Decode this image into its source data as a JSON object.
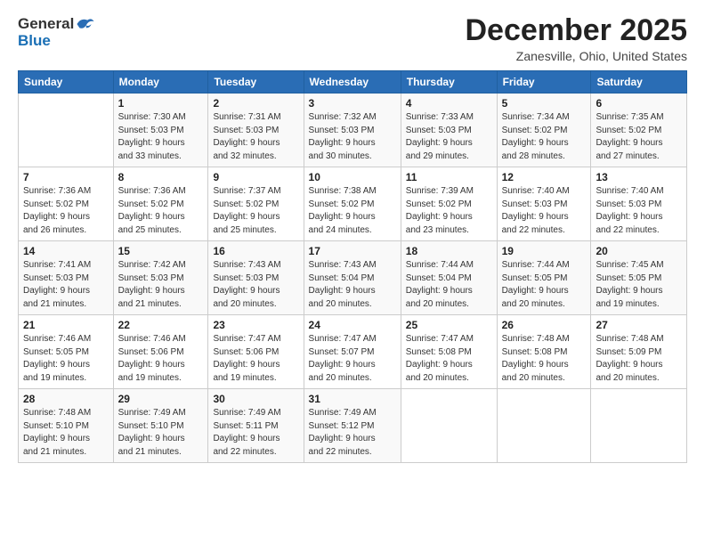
{
  "header": {
    "logo_line1": "General",
    "logo_line2": "Blue",
    "month": "December 2025",
    "location": "Zanesville, Ohio, United States"
  },
  "weekdays": [
    "Sunday",
    "Monday",
    "Tuesday",
    "Wednesday",
    "Thursday",
    "Friday",
    "Saturday"
  ],
  "weeks": [
    [
      {
        "day": "",
        "sunrise": "",
        "sunset": "",
        "daylight": ""
      },
      {
        "day": "1",
        "sunrise": "Sunrise: 7:30 AM",
        "sunset": "Sunset: 5:03 PM",
        "daylight": "Daylight: 9 hours and 33 minutes."
      },
      {
        "day": "2",
        "sunrise": "Sunrise: 7:31 AM",
        "sunset": "Sunset: 5:03 PM",
        "daylight": "Daylight: 9 hours and 32 minutes."
      },
      {
        "day": "3",
        "sunrise": "Sunrise: 7:32 AM",
        "sunset": "Sunset: 5:03 PM",
        "daylight": "Daylight: 9 hours and 30 minutes."
      },
      {
        "day": "4",
        "sunrise": "Sunrise: 7:33 AM",
        "sunset": "Sunset: 5:03 PM",
        "daylight": "Daylight: 9 hours and 29 minutes."
      },
      {
        "day": "5",
        "sunrise": "Sunrise: 7:34 AM",
        "sunset": "Sunset: 5:02 PM",
        "daylight": "Daylight: 9 hours and 28 minutes."
      },
      {
        "day": "6",
        "sunrise": "Sunrise: 7:35 AM",
        "sunset": "Sunset: 5:02 PM",
        "daylight": "Daylight: 9 hours and 27 minutes."
      }
    ],
    [
      {
        "day": "7",
        "sunrise": "Sunrise: 7:36 AM",
        "sunset": "Sunset: 5:02 PM",
        "daylight": "Daylight: 9 hours and 26 minutes."
      },
      {
        "day": "8",
        "sunrise": "Sunrise: 7:36 AM",
        "sunset": "Sunset: 5:02 PM",
        "daylight": "Daylight: 9 hours and 25 minutes."
      },
      {
        "day": "9",
        "sunrise": "Sunrise: 7:37 AM",
        "sunset": "Sunset: 5:02 PM",
        "daylight": "Daylight: 9 hours and 25 minutes."
      },
      {
        "day": "10",
        "sunrise": "Sunrise: 7:38 AM",
        "sunset": "Sunset: 5:02 PM",
        "daylight": "Daylight: 9 hours and 24 minutes."
      },
      {
        "day": "11",
        "sunrise": "Sunrise: 7:39 AM",
        "sunset": "Sunset: 5:02 PM",
        "daylight": "Daylight: 9 hours and 23 minutes."
      },
      {
        "day": "12",
        "sunrise": "Sunrise: 7:40 AM",
        "sunset": "Sunset: 5:03 PM",
        "daylight": "Daylight: 9 hours and 22 minutes."
      },
      {
        "day": "13",
        "sunrise": "Sunrise: 7:40 AM",
        "sunset": "Sunset: 5:03 PM",
        "daylight": "Daylight: 9 hours and 22 minutes."
      }
    ],
    [
      {
        "day": "14",
        "sunrise": "Sunrise: 7:41 AM",
        "sunset": "Sunset: 5:03 PM",
        "daylight": "Daylight: 9 hours and 21 minutes."
      },
      {
        "day": "15",
        "sunrise": "Sunrise: 7:42 AM",
        "sunset": "Sunset: 5:03 PM",
        "daylight": "Daylight: 9 hours and 21 minutes."
      },
      {
        "day": "16",
        "sunrise": "Sunrise: 7:43 AM",
        "sunset": "Sunset: 5:03 PM",
        "daylight": "Daylight: 9 hours and 20 minutes."
      },
      {
        "day": "17",
        "sunrise": "Sunrise: 7:43 AM",
        "sunset": "Sunset: 5:04 PM",
        "daylight": "Daylight: 9 hours and 20 minutes."
      },
      {
        "day": "18",
        "sunrise": "Sunrise: 7:44 AM",
        "sunset": "Sunset: 5:04 PM",
        "daylight": "Daylight: 9 hours and 20 minutes."
      },
      {
        "day": "19",
        "sunrise": "Sunrise: 7:44 AM",
        "sunset": "Sunset: 5:05 PM",
        "daylight": "Daylight: 9 hours and 20 minutes."
      },
      {
        "day": "20",
        "sunrise": "Sunrise: 7:45 AM",
        "sunset": "Sunset: 5:05 PM",
        "daylight": "Daylight: 9 hours and 19 minutes."
      }
    ],
    [
      {
        "day": "21",
        "sunrise": "Sunrise: 7:46 AM",
        "sunset": "Sunset: 5:05 PM",
        "daylight": "Daylight: 9 hours and 19 minutes."
      },
      {
        "day": "22",
        "sunrise": "Sunrise: 7:46 AM",
        "sunset": "Sunset: 5:06 PM",
        "daylight": "Daylight: 9 hours and 19 minutes."
      },
      {
        "day": "23",
        "sunrise": "Sunrise: 7:47 AM",
        "sunset": "Sunset: 5:06 PM",
        "daylight": "Daylight: 9 hours and 19 minutes."
      },
      {
        "day": "24",
        "sunrise": "Sunrise: 7:47 AM",
        "sunset": "Sunset: 5:07 PM",
        "daylight": "Daylight: 9 hours and 20 minutes."
      },
      {
        "day": "25",
        "sunrise": "Sunrise: 7:47 AM",
        "sunset": "Sunset: 5:08 PM",
        "daylight": "Daylight: 9 hours and 20 minutes."
      },
      {
        "day": "26",
        "sunrise": "Sunrise: 7:48 AM",
        "sunset": "Sunset: 5:08 PM",
        "daylight": "Daylight: 9 hours and 20 minutes."
      },
      {
        "day": "27",
        "sunrise": "Sunrise: 7:48 AM",
        "sunset": "Sunset: 5:09 PM",
        "daylight": "Daylight: 9 hours and 20 minutes."
      }
    ],
    [
      {
        "day": "28",
        "sunrise": "Sunrise: 7:48 AM",
        "sunset": "Sunset: 5:10 PM",
        "daylight": "Daylight: 9 hours and 21 minutes."
      },
      {
        "day": "29",
        "sunrise": "Sunrise: 7:49 AM",
        "sunset": "Sunset: 5:10 PM",
        "daylight": "Daylight: 9 hours and 21 minutes."
      },
      {
        "day": "30",
        "sunrise": "Sunrise: 7:49 AM",
        "sunset": "Sunset: 5:11 PM",
        "daylight": "Daylight: 9 hours and 22 minutes."
      },
      {
        "day": "31",
        "sunrise": "Sunrise: 7:49 AM",
        "sunset": "Sunset: 5:12 PM",
        "daylight": "Daylight: 9 hours and 22 minutes."
      },
      {
        "day": "",
        "sunrise": "",
        "sunset": "",
        "daylight": ""
      },
      {
        "day": "",
        "sunrise": "",
        "sunset": "",
        "daylight": ""
      },
      {
        "day": "",
        "sunrise": "",
        "sunset": "",
        "daylight": ""
      }
    ]
  ]
}
